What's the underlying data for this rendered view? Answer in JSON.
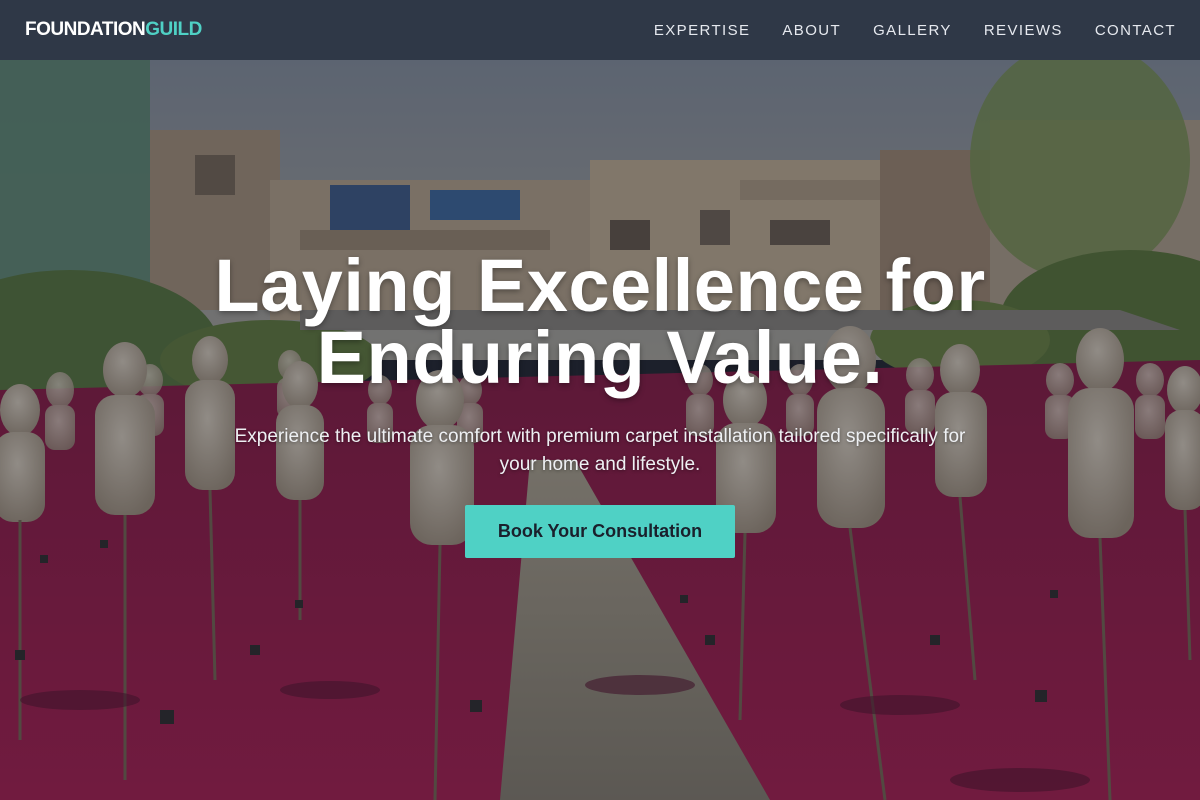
{
  "header": {
    "logo_primary": "FOUNDATION",
    "logo_accent": "GUILD",
    "nav": [
      "EXPERTISE",
      "ABOUT",
      "GALLERY",
      "REVIEWS",
      "CONTACT"
    ]
  },
  "hero": {
    "headline_line1": "Laying Excellence for",
    "headline_line2": "Enduring Value.",
    "subtext_line1": "Experience the ultimate comfort with premium carpet installation tailored specifically for",
    "subtext_line2": "your home and lifestyle.",
    "cta_label": "Book Your Consultation",
    "background_image": "photo-courtyard-red-carpet-mannequins"
  },
  "colors": {
    "header_bg": "#2f3847",
    "accent": "#4fd1c5",
    "carpet": "#a8144a"
  }
}
